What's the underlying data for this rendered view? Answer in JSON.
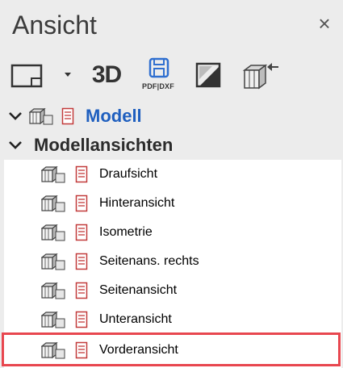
{
  "panel": {
    "title": "Ansicht",
    "close_label": "×"
  },
  "toolbar": {
    "view_layout_icon": "viewport-layout-icon",
    "dropdown_icon": "triangle-down-icon",
    "btn_3d_label": "3D",
    "pdf_dxf_label": "PDF|DXF",
    "section_icon": "section-view-icon",
    "export_view_icon": "view-export-icon"
  },
  "tree": {
    "root": {
      "label": "Modell",
      "color": "#1f5fbf"
    },
    "group": {
      "label": "Modellansichten"
    },
    "items": [
      {
        "label": "Draufsicht"
      },
      {
        "label": "Hinteransicht"
      },
      {
        "label": "Isometrie"
      },
      {
        "label": "Seitenans. rechts"
      },
      {
        "label": "Seitenansicht"
      },
      {
        "label": "Unteransicht"
      },
      {
        "label": "Vorderansicht"
      }
    ],
    "selected_index": 6,
    "highlight_color": "#e8474f"
  }
}
